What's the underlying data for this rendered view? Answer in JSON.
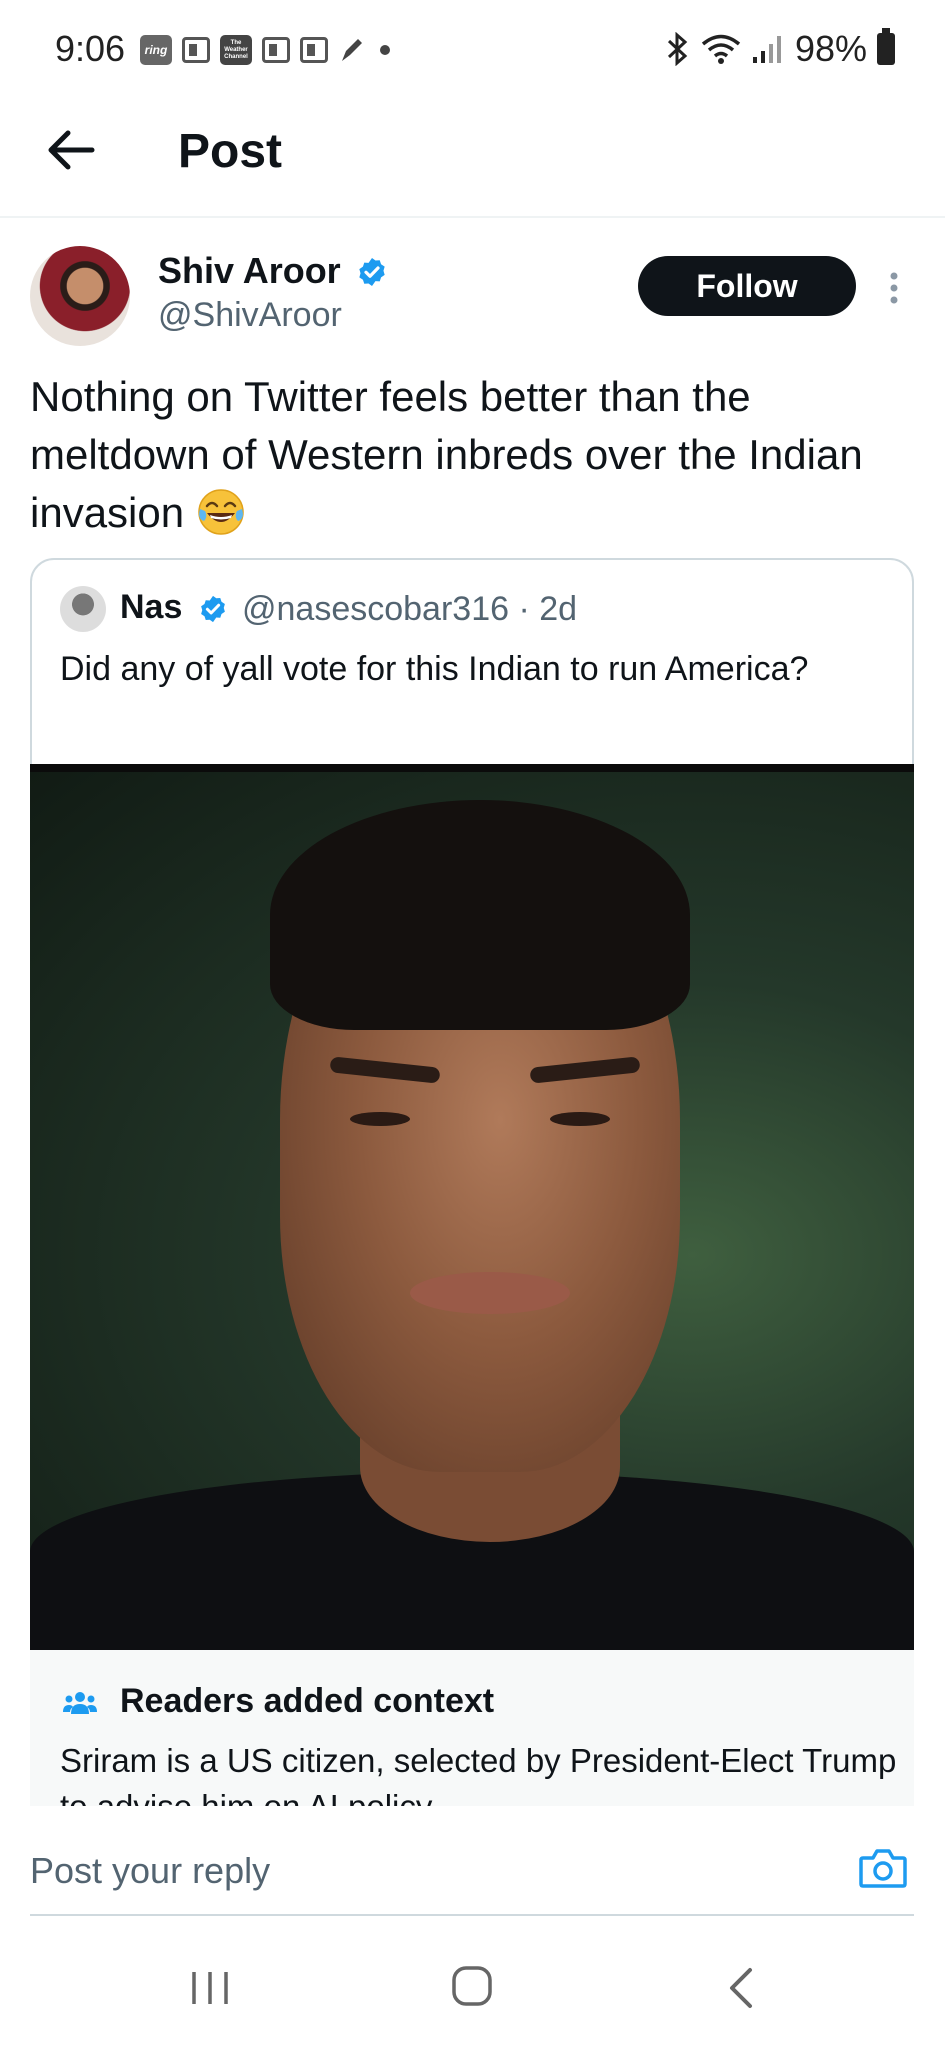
{
  "status_bar": {
    "time": "9:06",
    "ring_label": "ring",
    "weather_label": "The Weather Channel",
    "battery": "98%"
  },
  "header": {
    "title": "Post"
  },
  "post": {
    "author_name": "Shiv Aroor",
    "author_handle": "@ShivAroor",
    "follow_label": "Follow",
    "text": "Nothing on Twitter feels better than the meltdown of Western inbreds over the Indian invasion",
    "emoji": "face-with-tears-of-joy"
  },
  "quoted_post": {
    "author_name": "Nas",
    "author_handle": "@nasescobar316 · 2d",
    "text": "Did any of yall vote for this Indian to run America?"
  },
  "readers_context": {
    "title": "Readers added context",
    "text": "Sriram is a US citizen, selected by President-Elect Trump to advise him on AI policy."
  },
  "reply_bar": {
    "placeholder": "Post your reply"
  },
  "colors": {
    "verified_blue": "#1d9bf0",
    "text_primary": "#0f1419",
    "text_secondary": "#536471",
    "follow_button": "#0f1419"
  }
}
